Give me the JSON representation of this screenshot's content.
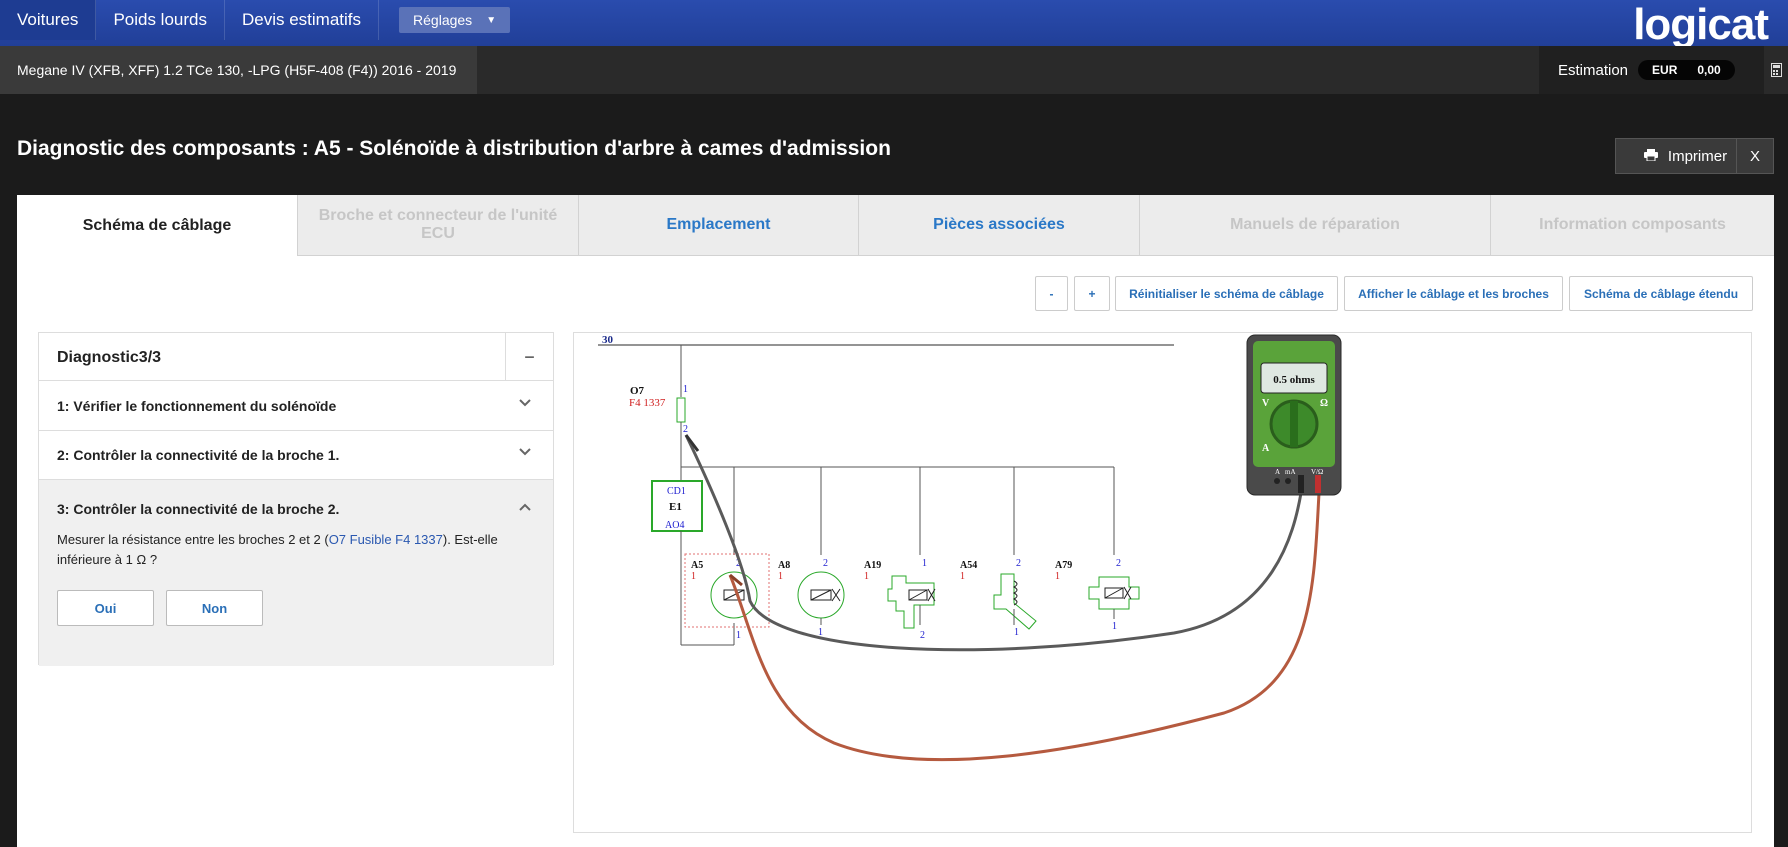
{
  "nav": {
    "items": [
      "Voitures",
      "Poids lourds",
      "Devis estimatifs"
    ],
    "settings_label": "Réglages",
    "logo": "logicat"
  },
  "vehicle": {
    "name": "Megane IV (XFB, XFF) 1.2 TCe 130, -LPG (H5F-408 (F4)) 2016 - 2019"
  },
  "estimation": {
    "label": "Estimation",
    "currency": "EUR",
    "value": "0,00"
  },
  "page": {
    "title": "Diagnostic des composants : A5 - Solénoïde à distribution d'arbre à cames d'admission",
    "print_label": "Imprimer",
    "close_label": "X"
  },
  "tabs": [
    {
      "label": "Schéma de câblage"
    },
    {
      "label": "Broche et connecteur de l'unité ECU"
    },
    {
      "label": "Emplacement"
    },
    {
      "label": "Pièces associées"
    },
    {
      "label": "Manuels de réparation"
    },
    {
      "label": "Information composants"
    }
  ],
  "toolbar": {
    "zoom_out": "-",
    "zoom_in": "+",
    "reset": "Réinitialiser le schéma de câblage",
    "show_pins": "Afficher le câblage et les broches",
    "extended": "Schéma de câblage étendu"
  },
  "diagnostic": {
    "title": "Diagnostic3/3",
    "toggle": "−",
    "steps": [
      {
        "label": "1: Vérifier le fonctionnement du solénoïde"
      },
      {
        "label": "2: Contrôler la connectivité de la broche 1."
      },
      {
        "label": "3: Contrôler la connectivité de la broche 2."
      }
    ],
    "instruction_pre": "Mesurer la résistance entre les broches 2 et 2 (",
    "instruction_ref": "O7 Fusible F4 1337",
    "instruction_post": "). Est-elle inférieure à 1 Ω ?",
    "yes_label": "Oui",
    "no_label": "Non"
  },
  "schematic": {
    "bus_label": "30",
    "fuse_label": "O7",
    "fuse_ref": "F4 1337",
    "fuse_pin_top": "1",
    "fuse_pin_bottom": "2",
    "connector_top": "CD1",
    "connector_mid": "E1",
    "connector_bottom": "AO4",
    "components": [
      {
        "name": "A5",
        "pin_top": "2",
        "pin_left": "1",
        "pin_bottom": "1"
      },
      {
        "name": "A8",
        "pin_top": "2",
        "pin_left": "1",
        "pin_bottom": "1"
      },
      {
        "name": "A19",
        "pin_top": "1",
        "pin_left": "1",
        "pin_bottom": "2"
      },
      {
        "name": "A54",
        "pin_top": "2",
        "pin_left": "1",
        "pin_bottom": "1"
      },
      {
        "name": "A79",
        "pin_top": "2",
        "pin_left": "1",
        "pin_bottom": "1"
      }
    ],
    "multimeter": {
      "reading": "0.5 ohms",
      "dial_v": "V",
      "dial_ohm": "Ω",
      "dial_a": "A",
      "jack_a": "A",
      "jack_ma": "mA",
      "jack_vohm": "V/Ω"
    }
  }
}
